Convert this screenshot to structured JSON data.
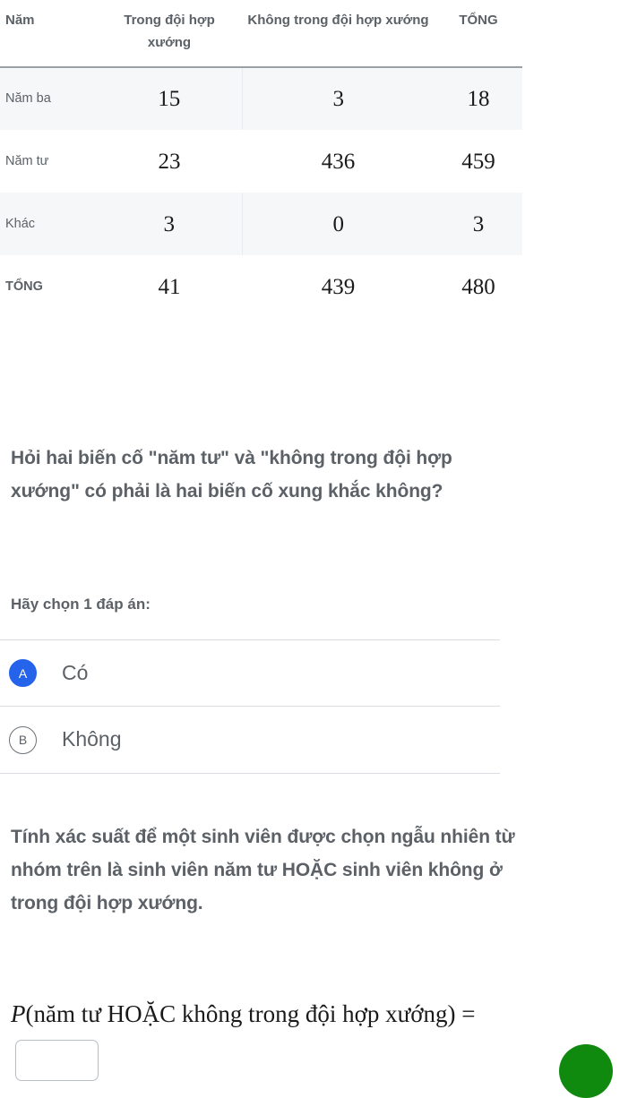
{
  "table": {
    "headers": [
      "Năm",
      "Trong đội hợp xướng",
      "Không trong đội hợp xướng",
      "TỔNG"
    ],
    "rows": [
      {
        "label": "Năm ba",
        "in_choir": "15",
        "not_in_choir": "3",
        "total": "18"
      },
      {
        "label": "Năm tư",
        "in_choir": "23",
        "not_in_choir": "436",
        "total": "459"
      },
      {
        "label": "Khác",
        "in_choir": "3",
        "not_in_choir": "0",
        "total": "3"
      },
      {
        "label": "TỔNG",
        "in_choir": "41",
        "not_in_choir": "439",
        "total": "480"
      }
    ]
  },
  "question": {
    "text": "Hỏi hai biến cố \"năm tư\" và \"không trong đội hợp xướng\" có phải là hai biến cố xung khắc không?",
    "choose_prompt": "Hãy chọn 1 đáp án:",
    "options": [
      {
        "badge": "A",
        "label": "Có",
        "selected": true
      },
      {
        "badge": "B",
        "label": "Không",
        "selected": false
      }
    ]
  },
  "task": {
    "text": "Tính xác suất để một sinh viên được chọn ngẫu nhiên từ nhóm trên là sinh viên năm tư HOẶC sinh viên không ở trong đội hợp xướng."
  },
  "formula": {
    "p_symbol": "P",
    "expression": "(năm tư HOẶC không trong đội hợp xướng)",
    "equals": "=",
    "answer_value": ""
  },
  "colors": {
    "accent_blue": "#2563eb",
    "fab_green": "#0f8a0f",
    "text_gray": "#5b6166",
    "stripe_bg": "#f6f7f9",
    "border_gray": "#d9dde1"
  }
}
